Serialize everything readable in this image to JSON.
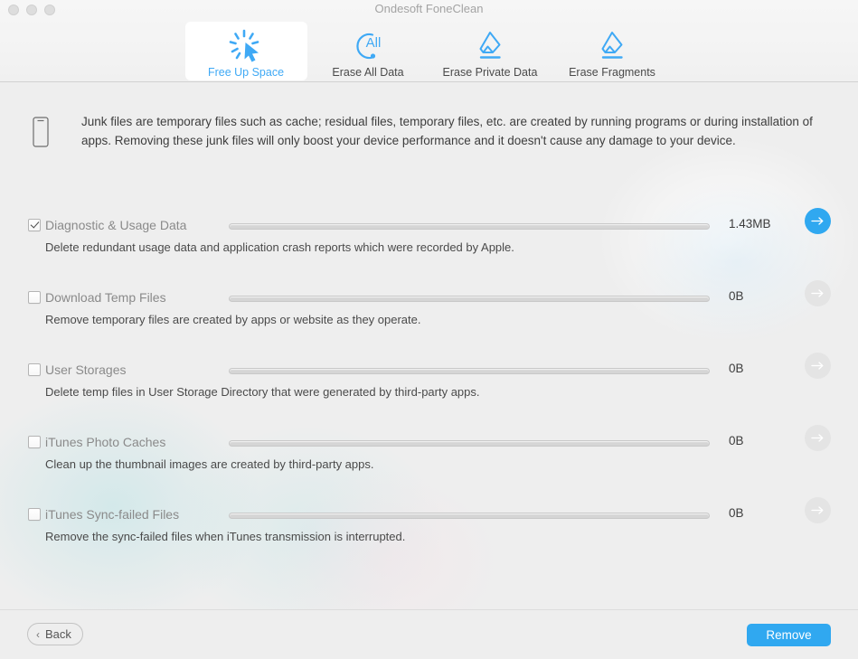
{
  "window": {
    "title": "Ondesoft FoneClean",
    "traffic_lights": [
      "close-button",
      "minimize-button",
      "zoom-button"
    ]
  },
  "toolbar": {
    "items": [
      {
        "label": "Free Up Space",
        "icon": "click-sparkle-icon",
        "selected": true
      },
      {
        "label": "Erase All Data",
        "icon": "erase-all-circle-icon",
        "selected": false
      },
      {
        "label": "Erase Private Data",
        "icon": "eraser-icon",
        "selected": false
      },
      {
        "label": "Erase Fragments",
        "icon": "eraser-icon",
        "selected": false
      }
    ]
  },
  "banner": {
    "icon": "phone-device-icon",
    "text": "Junk files are temporary files such as cache; residual files, temporary files, etc. are created by running programs or during installation of apps. Removing these junk files will only boost your device performance and it doesn't cause any damage to your device."
  },
  "items": [
    {
      "title": "Diagnostic & Usage Data",
      "description": "Delete redundant usage data and application crash reports which were recorded by Apple.",
      "size": "1.43MB",
      "checked": true,
      "progress": 0,
      "arrow_enabled": true
    },
    {
      "title": "Download Temp Files",
      "description": "Remove temporary files are created by apps or website as they operate.",
      "size": "0B",
      "checked": false,
      "progress": 0,
      "arrow_enabled": false
    },
    {
      "title": "User Storages",
      "description": "Delete temp files in User Storage Directory that were generated by third-party apps.",
      "size": "0B",
      "checked": false,
      "progress": 0,
      "arrow_enabled": false
    },
    {
      "title": "iTunes Photo Caches",
      "description": "Clean up the thumbnail images are created by third-party apps.",
      "size": "0B",
      "checked": false,
      "progress": 0,
      "arrow_enabled": false
    },
    {
      "title": "iTunes Sync-failed Files",
      "description": "Remove the sync-failed files when iTunes transmission is interrupted.",
      "size": "0B",
      "checked": false,
      "progress": 0,
      "arrow_enabled": false
    }
  ],
  "footer": {
    "back_label": "Back",
    "back_chevron": "‹",
    "remove_label": "Remove"
  },
  "colors": {
    "accent": "#30a8f0",
    "accent_label": "#3fa9f5",
    "window_bg": "#eeeeee",
    "titlebar_bg": "#f4f4f4",
    "title_text": "#a3a3a3",
    "row_title": "#8a8a8a",
    "body_text": "#3d3d3d",
    "track": "#d5d5d5",
    "disabled_btn": "#e4e4e4"
  }
}
